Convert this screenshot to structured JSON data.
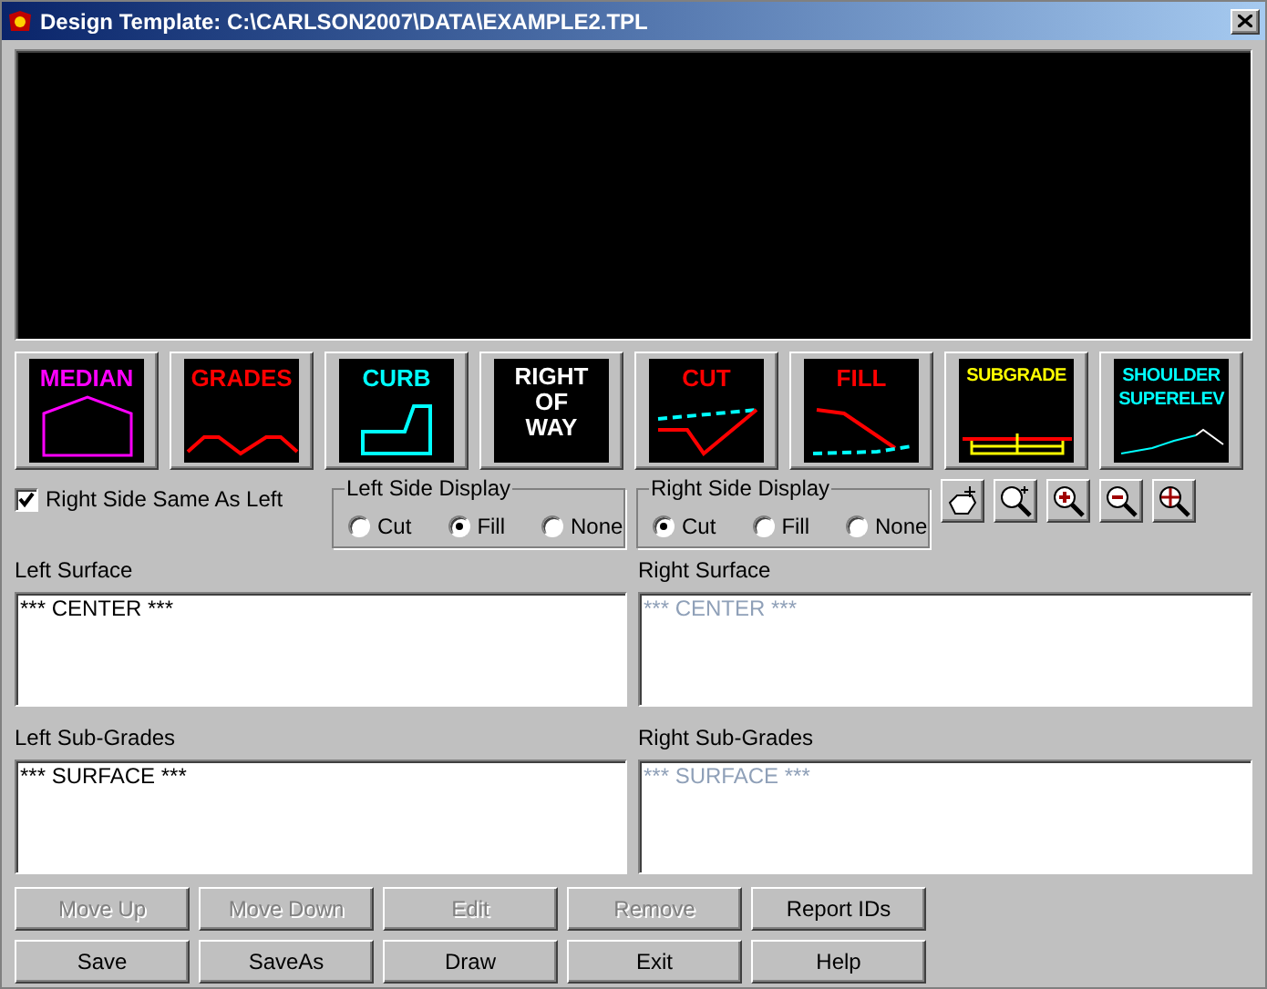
{
  "window": {
    "title": "Design Template: C:\\CARLSON2007\\DATA\\EXAMPLE2.TPL"
  },
  "tiles": [
    {
      "label": "MEDIAN",
      "kind": "median",
      "color": "#ff00ff"
    },
    {
      "label": "GRADES",
      "kind": "grades",
      "color": "#ff0000"
    },
    {
      "label": "CURB",
      "kind": "curb",
      "color": "#00ffff"
    },
    {
      "label": "RIGHT OF WAY",
      "kind": "row",
      "color": "#ffffff"
    },
    {
      "label": "CUT",
      "kind": "cut",
      "color": "#ff0000"
    },
    {
      "label": "FILL",
      "kind": "fill",
      "color": "#ff0000"
    },
    {
      "label": "SUBGRADE",
      "kind": "subgrade",
      "color": "#ffff00"
    },
    {
      "label": "SHOULDER SUPERELEV",
      "kind": "shoulder",
      "color": "#00ffff"
    }
  ],
  "same_side": {
    "label": "Right Side Same As Left",
    "checked": true
  },
  "displays": [
    {
      "title": "Left Side Display",
      "options": [
        {
          "label": "Cut",
          "selected": false
        },
        {
          "label": "Fill",
          "selected": true
        },
        {
          "label": "None",
          "selected": false
        }
      ]
    },
    {
      "title": "Right Side Display",
      "options": [
        {
          "label": "Cut",
          "selected": true
        },
        {
          "label": "Fill",
          "selected": false
        },
        {
          "label": "None",
          "selected": false
        }
      ]
    }
  ],
  "tools": [
    {
      "kind": "pan"
    },
    {
      "kind": "zoom-dynamic"
    },
    {
      "kind": "zoom-in"
    },
    {
      "kind": "zoom-out"
    },
    {
      "kind": "zoom-extents"
    }
  ],
  "lists": [
    {
      "label": "Left Surface",
      "items": [
        "*** CENTER ***"
      ],
      "disabled": false
    },
    {
      "label": "Right Surface",
      "items": [
        "*** CENTER ***"
      ],
      "disabled": true
    },
    {
      "label": "Left Sub-Grades",
      "items": [
        "*** SURFACE ***"
      ],
      "disabled": false
    },
    {
      "label": "Right Sub-Grades",
      "items": [
        "*** SURFACE ***"
      ],
      "disabled": true
    }
  ],
  "buttons": [
    {
      "label": "Move Up",
      "disabled": true
    },
    {
      "label": "Move Down",
      "disabled": true
    },
    {
      "label": "Edit",
      "disabled": true
    },
    {
      "label": "Remove",
      "disabled": true
    },
    {
      "label": "Report IDs",
      "disabled": false
    },
    {
      "label": "Save",
      "disabled": false
    },
    {
      "label": "SaveAs",
      "disabled": false
    },
    {
      "label": "Draw",
      "disabled": false
    },
    {
      "label": "Exit",
      "disabled": false
    },
    {
      "label": "Help",
      "disabled": false
    }
  ]
}
